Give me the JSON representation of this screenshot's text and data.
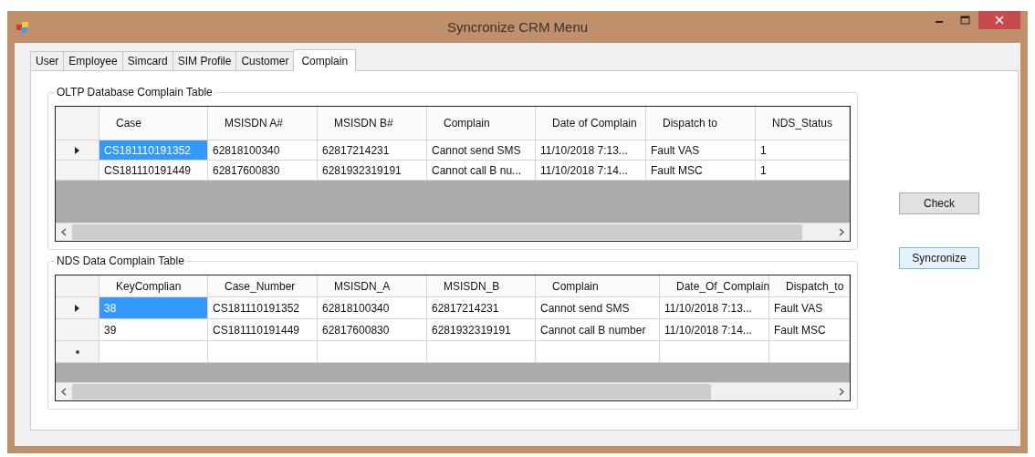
{
  "window": {
    "title": "Syncronize CRM Menu"
  },
  "tabs": [
    {
      "label": "User",
      "selected": false
    },
    {
      "label": "Employee",
      "selected": false
    },
    {
      "label": "Simcard",
      "selected": false
    },
    {
      "label": "SIM Profile",
      "selected": false
    },
    {
      "label": "Customer",
      "selected": false
    },
    {
      "label": "Complain",
      "selected": true
    }
  ],
  "oltp_table": {
    "title": "OLTP Database Complain Table",
    "columns": [
      "Case",
      "MSISDN A#",
      "MSISDN B#",
      "Complain",
      "Date of Complain",
      "Dispatch to",
      "NDS_Status"
    ],
    "rows": [
      {
        "selected": true,
        "cells": [
          "CS181110191352",
          "62818100340",
          "62817214231",
          "Cannot send SMS",
          "11/10/2018 7:13...",
          "Fault VAS",
          "1"
        ]
      },
      {
        "selected": false,
        "cells": [
          "CS181110191449",
          "62817600830",
          "6281932319191",
          "Cannot call B nu...",
          "11/10/2018 7:14...",
          "Fault MSC",
          "1"
        ]
      }
    ]
  },
  "nds_table": {
    "title": "NDS Data Complain Table",
    "columns": [
      "KeyComplian",
      "Case_Number",
      "MSISDN_A",
      "MSISDN_B",
      "Complain",
      "Date_Of_Complain",
      "Dispatch_to"
    ],
    "rows": [
      {
        "selected": true,
        "cells": [
          "38",
          "CS181110191352",
          "62818100340",
          "62817214231",
          "Cannot send SMS",
          "11/10/2018 7:13...",
          "Fault VAS"
        ]
      },
      {
        "selected": false,
        "cells": [
          "39",
          "CS181110191449",
          "62817600830",
          "6281932319191",
          "Cannot call B number",
          "11/10/2018 7:14...",
          "Fault MSC"
        ]
      }
    ],
    "new_row": true
  },
  "buttons": [
    {
      "label": "Check",
      "focused": false
    },
    {
      "label": "Syncronize",
      "focused": true
    }
  ]
}
